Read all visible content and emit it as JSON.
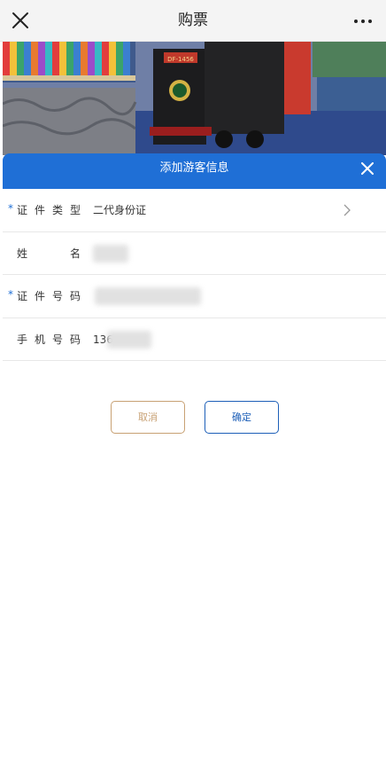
{
  "topbar": {
    "title": "购票",
    "close_icon": "close-icon",
    "more_icon": "more-dots-icon"
  },
  "banner": {
    "train_sign": "DF-1456"
  },
  "modal": {
    "title": "添加游客信息",
    "close_icon": "close-icon",
    "accent": "#1f6fd6"
  },
  "form": {
    "fields": [
      {
        "required": true,
        "label_chars": [
          "证",
          "件",
          "类",
          "型"
        ],
        "value": "二代身份证",
        "has_chevron": true
      },
      {
        "required": false,
        "label_chars": [
          "姓",
          "名"
        ],
        "value": ""
      },
      {
        "required": true,
        "label_chars": [
          "证",
          "件",
          "号",
          "码"
        ],
        "value": ""
      },
      {
        "required": false,
        "label_chars": [
          "手",
          "机",
          "号",
          "码"
        ],
        "value": "136"
      }
    ],
    "required_mark": "*"
  },
  "actions": {
    "cancel_label": "取消",
    "confirm_label": "确定",
    "cancel_color": "#c8a174",
    "confirm_color": "#1d5fb8"
  }
}
